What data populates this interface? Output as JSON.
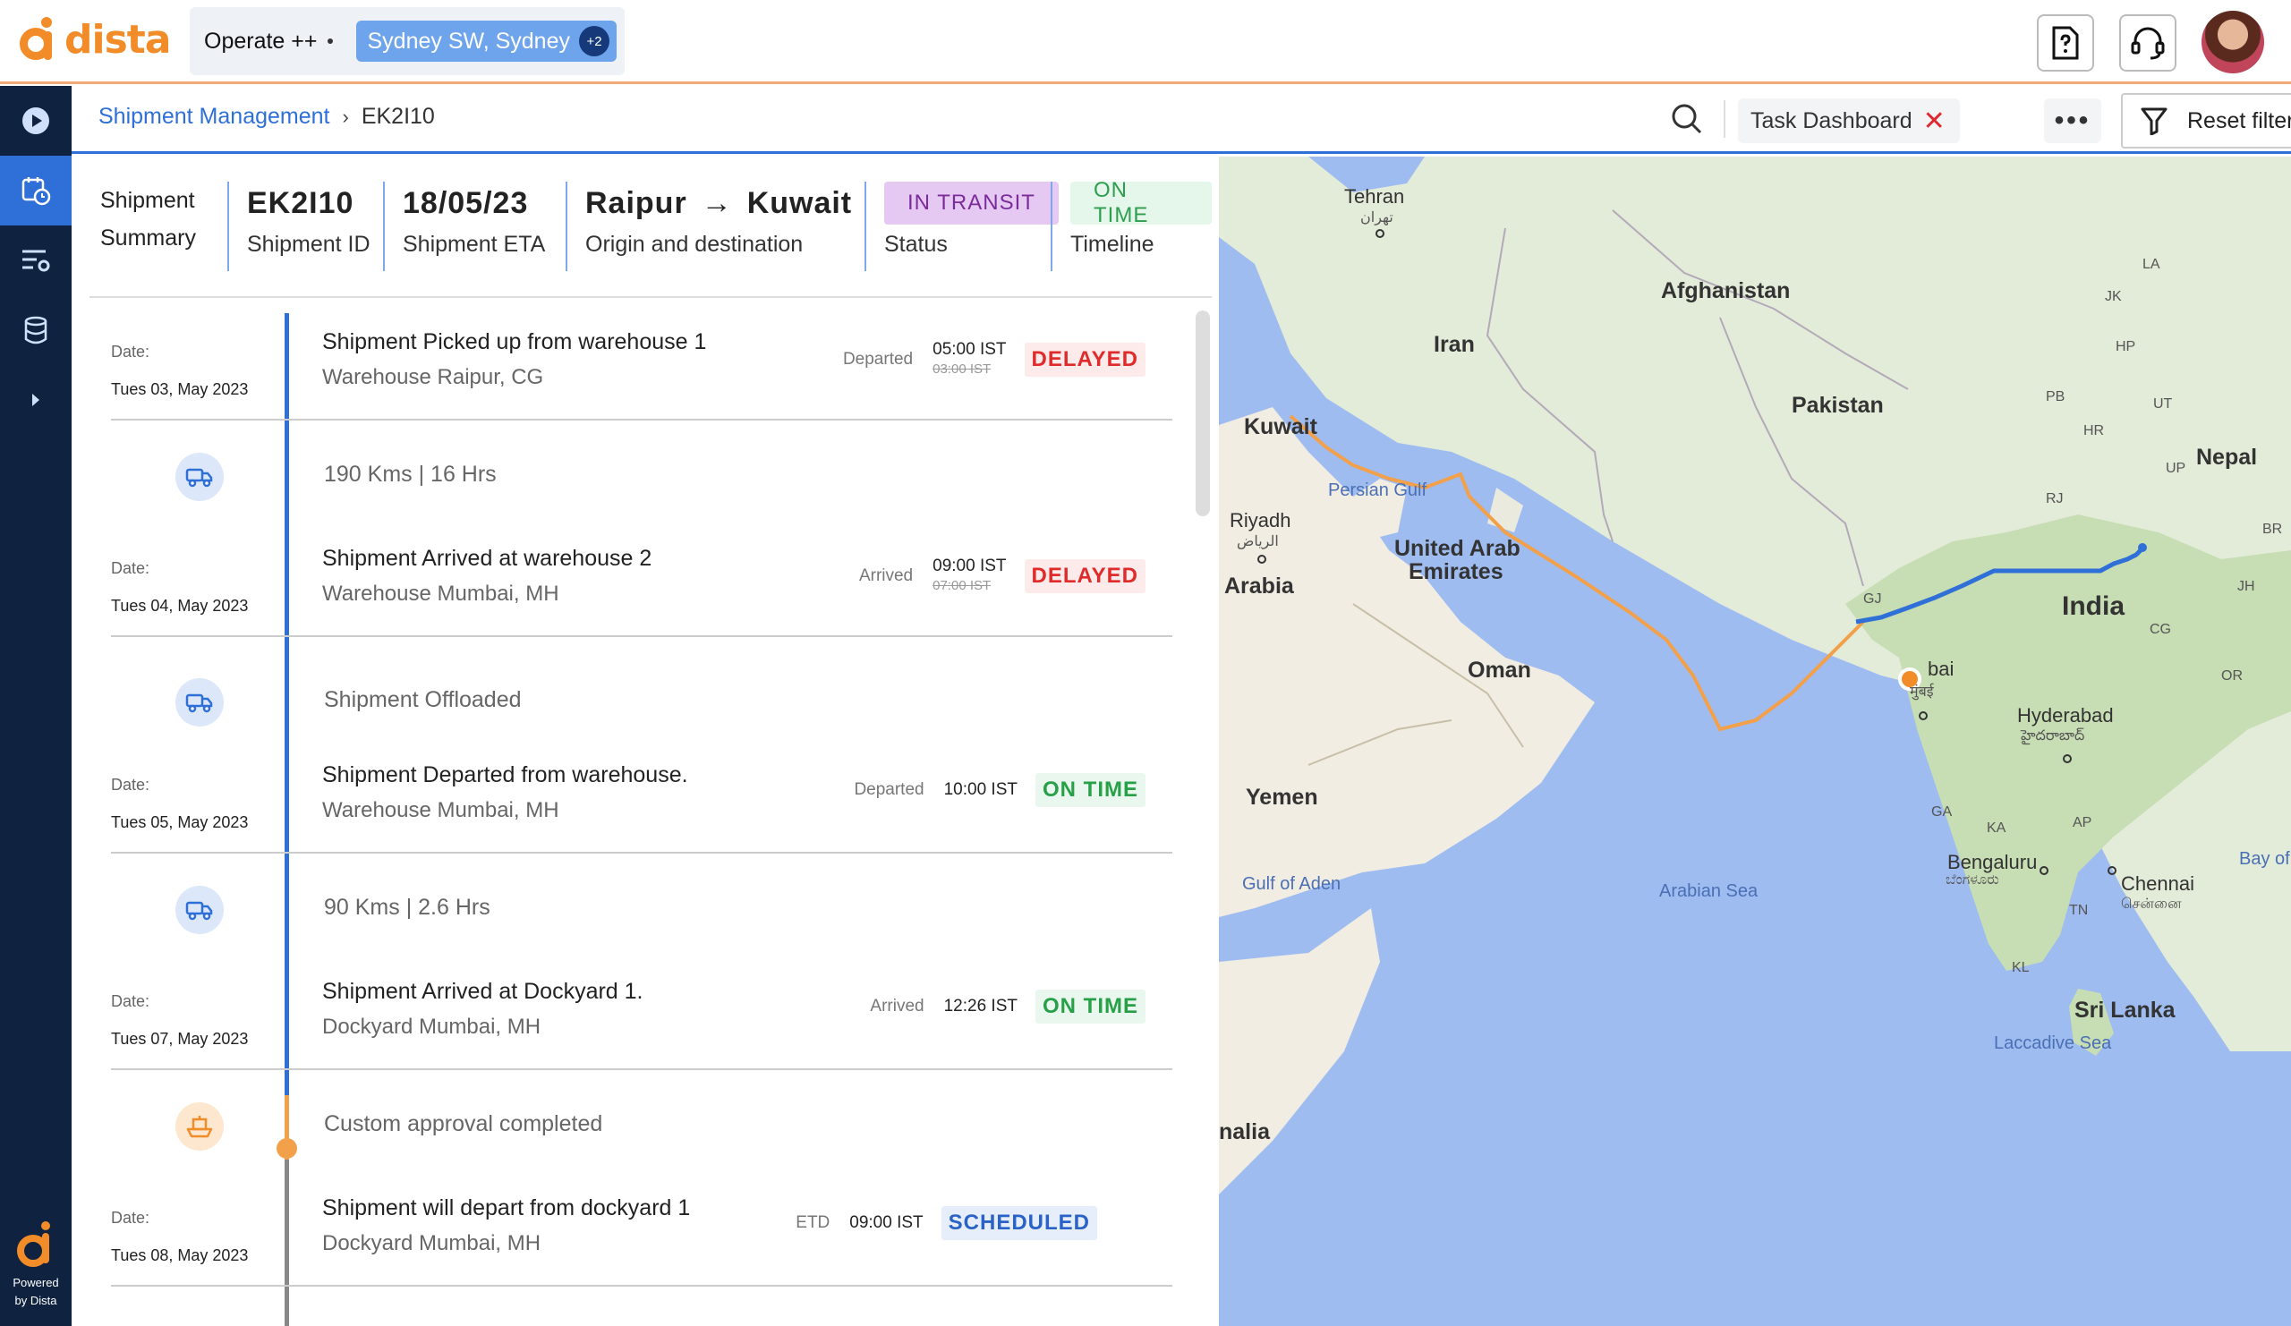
{
  "brand": {
    "logo_text": "dista",
    "accent": "#f28c28",
    "nav_bg": "#0f2341",
    "primary": "#2f6fd8"
  },
  "context": {
    "app": "Operate ++",
    "location": "Sydney SW, Sydney",
    "extra_count": "+2"
  },
  "header_buttons": [
    "help-document-icon",
    "support-headset-icon"
  ],
  "nav": {
    "items": [
      "play-icon",
      "calendar-clock-icon",
      "list-settings-icon",
      "database-icon",
      "chevron-right-icon"
    ],
    "powered_line1": "Powered",
    "powered_line2": "by Dista"
  },
  "breadcrumb": {
    "parent": "Shipment Management",
    "separator": "›",
    "current": "EK2I10"
  },
  "filters": {
    "chip": "Task Dashboard",
    "more": "•••",
    "reset": "Reset filter"
  },
  "summary": {
    "title_line1": "Shipment",
    "title_line2": "Summary",
    "shipment_id": "EK2I10",
    "shipment_id_label": "Shipment ID",
    "eta": "18/05/23",
    "eta_label": "Shipment ETA",
    "origin": "Raipur",
    "arrow": "→",
    "destination": "Kuwait",
    "route_label": "Origin and destination",
    "status": "IN TRANSIT",
    "status_label": "Status",
    "timeline": "ON TIME",
    "timeline_label": "Timeline"
  },
  "events": [
    {
      "date_label": "Date:",
      "date": "Tues 03, May 2023",
      "title": "Shipment Picked up from warehouse 1",
      "location": "Warehouse Raipur, CG",
      "kind": "Departed",
      "time": "05:00 IST",
      "planned": "03:00 IST",
      "status": "DELAYED"
    },
    {
      "date_label": "Date:",
      "date": "Tues 04, May 2023",
      "title": "Shipment Arrived at warehouse 2",
      "location": "Warehouse Mumbai, MH",
      "kind": "Arrived",
      "time": "09:00 IST",
      "planned": "07:00 IST",
      "status": "DELAYED"
    },
    {
      "date_label": "Date:",
      "date": "Tues 05, May 2023",
      "title": "Shipment Departed from warehouse.",
      "location": "Warehouse Mumbai, MH",
      "kind": "Departed",
      "time": "10:00 IST",
      "planned": "",
      "status": "ON TIME"
    },
    {
      "date_label": "Date:",
      "date": "Tues 07, May 2023",
      "title": "Shipment Arrived at Dockyard 1.",
      "location": "Dockyard Mumbai, MH",
      "kind": "Arrived",
      "time": "12:26 IST",
      "planned": "",
      "status": "ON TIME"
    },
    {
      "date_label": "Date:",
      "date": "Tues 08, May 2023",
      "title": "Shipment will depart from dockyard 1",
      "location": "Dockyard Mumbai, MH",
      "kind": "ETD",
      "time": "09:00 IST",
      "planned": "",
      "status": "SCHEDULED"
    }
  ],
  "gaps": [
    {
      "icon": "truck-icon",
      "text": "190 Kms | 16 Hrs"
    },
    {
      "icon": "truck-icon",
      "text": "Shipment Offloaded"
    },
    {
      "icon": "truck-icon",
      "text": "90 Kms | 2.6 Hrs"
    },
    {
      "icon": "ship-icon",
      "text": "Custom approval completed"
    }
  ],
  "map": {
    "countries": [
      "Afghanistan",
      "Iran",
      "Pakistan",
      "Nepal",
      "Kuwait",
      "Arabia",
      "United Arab",
      "Emirates",
      "Oman",
      "Yemen",
      "India",
      "Sri Lanka"
    ],
    "cities": [
      "Tehran",
      "تهران",
      "Riyadh",
      "الرياض",
      "Hyderabad",
      "హైదరాబాద్",
      "Bengaluru",
      "ಬೆಂಗಳೂರು",
      "Chennai",
      "சென்னை",
      "bai",
      "मुंबई"
    ],
    "water": [
      "Persian Gulf",
      "Gulf of Aden",
      "Arabian Sea",
      "Laccadive Sea",
      "Bay of"
    ],
    "states": [
      "LA",
      "JK",
      "HP",
      "PB",
      "UT",
      "HR",
      "UP",
      "RJ",
      "BR",
      "JH",
      "GJ",
      "CG",
      "OR",
      "GA",
      "KA",
      "AP",
      "TN",
      "KL"
    ],
    "edge": "nalia",
    "route_colors": {
      "sea": "#f2a04a",
      "land": "#2f6fd8"
    }
  }
}
